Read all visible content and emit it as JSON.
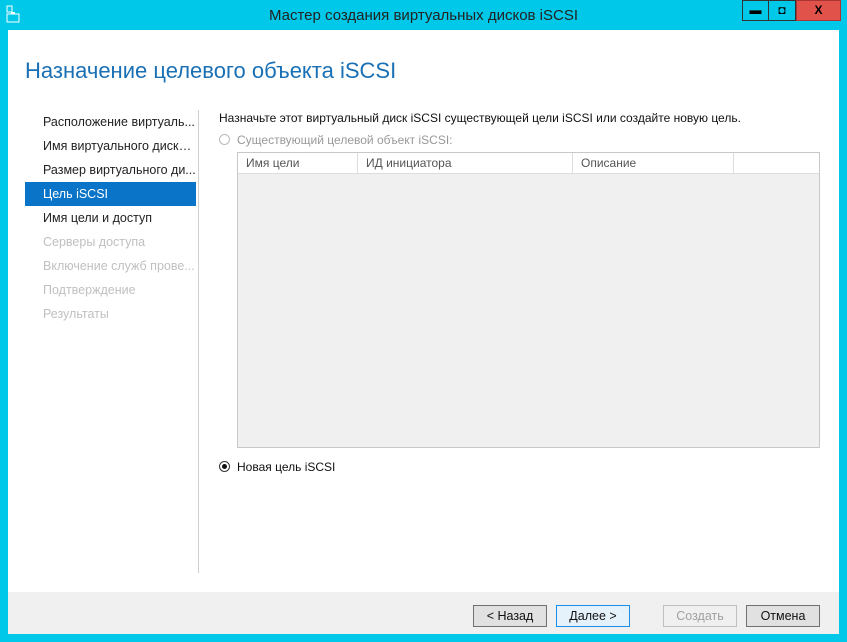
{
  "window": {
    "title": "Мастер создания виртуальных дисков iSCSI",
    "min": "▬",
    "max": "◘",
    "close": "X"
  },
  "heading": "Назначение целевого объекта iSCSI",
  "nav": [
    {
      "label": "Расположение виртуаль...",
      "state": "normal"
    },
    {
      "label": "Имя виртуального диска...",
      "state": "normal"
    },
    {
      "label": "Размер виртуального ди...",
      "state": "normal"
    },
    {
      "label": "Цель iSCSI",
      "state": "selected"
    },
    {
      "label": "Имя цели и доступ",
      "state": "normal"
    },
    {
      "label": "Серверы доступа",
      "state": "disabled"
    },
    {
      "label": "Включение служб прове...",
      "state": "disabled"
    },
    {
      "label": "Подтверждение",
      "state": "disabled"
    },
    {
      "label": "Результаты",
      "state": "disabled"
    }
  ],
  "intro": "Назначьте этот виртуальный диск iSCSI существующей цели iSCSI или создайте новую цель.",
  "existing_option": {
    "label": "Существующий целевой объект iSCSI:",
    "selected": false,
    "enabled": false
  },
  "table": {
    "columns": [
      "Имя цели",
      "ИД инициатора",
      "Описание",
      ""
    ],
    "rows": []
  },
  "new_option": {
    "label": "Новая цель iSCSI",
    "selected": true
  },
  "buttons": {
    "back": "< Назад",
    "next": "Далее >",
    "create": "Создать",
    "cancel": "Отмена"
  }
}
